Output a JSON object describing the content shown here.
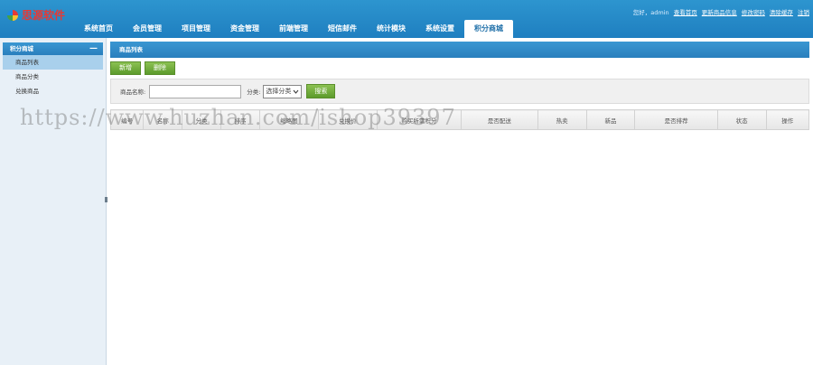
{
  "header": {
    "logo_text": "思源软件",
    "nav": [
      "系统首页",
      "会员管理",
      "项目管理",
      "资金管理",
      "前端管理",
      "短信邮件",
      "统计模块",
      "系统设置",
      "积分商城"
    ],
    "active_index": 8,
    "user_greeting": "您好，admin",
    "user_links": [
      "查看首页",
      "更新商品信息",
      "修改密码",
      "清除缓存",
      "注销"
    ]
  },
  "sidebar": {
    "title": "积分商城",
    "collapse_symbol": "—",
    "items": [
      "商品列表",
      "商品分类",
      "兑换商品"
    ],
    "active_index": 0
  },
  "main": {
    "panel_title": "商品列表",
    "buttons": {
      "add": "新增",
      "delete": "删除"
    },
    "search": {
      "name_label": "商品名称:",
      "name_value": "",
      "category_label": "分类:",
      "category_selected": "选择分类",
      "submit": "搜索"
    },
    "table_headers": [
      "编号",
      "名称",
      "分类",
      "排序",
      "缩略图",
      "兑换价",
      "购买所需积分",
      "是否配送",
      "热卖",
      "新品",
      "是否排荐",
      "状态",
      "操作"
    ]
  },
  "watermark": "https://www.huzhan.com/ishop39397"
}
